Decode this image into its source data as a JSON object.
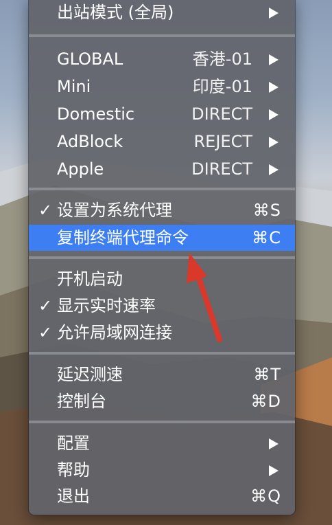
{
  "menu": {
    "top_item": {
      "label": "出站模式 (全局)"
    },
    "proxy_groups": [
      {
        "name": "GLOBAL",
        "value": "香港-01"
      },
      {
        "name": "Mini",
        "value": "印度-01"
      },
      {
        "name": "Domestic",
        "value": "DIRECT"
      },
      {
        "name": "AdBlock",
        "value": "REJECT"
      },
      {
        "name": "Apple",
        "value": "DIRECT"
      }
    ],
    "proxy_section": [
      {
        "label": "设置为系统代理",
        "checked": true,
        "checkmark": "✓",
        "shortcut": "⌘S"
      },
      {
        "label": "复制终端代理命令",
        "checked": false,
        "checkmark": "",
        "shortcut": "⌘C",
        "highlighted": true
      }
    ],
    "startup_section": [
      {
        "label": "开机启动",
        "checked": false,
        "checkmark": ""
      },
      {
        "label": "显示实时速率",
        "checked": true,
        "checkmark": "✓"
      },
      {
        "label": "允许局域网连接",
        "checked": true,
        "checkmark": "✓"
      }
    ],
    "tools_section": [
      {
        "label": "延迟测速",
        "shortcut": "⌘T"
      },
      {
        "label": "控制台",
        "shortcut": "⌘D"
      }
    ],
    "bottom_section": [
      {
        "label": "配置",
        "submenu": true
      },
      {
        "label": "帮助",
        "submenu": true
      },
      {
        "label": "退出",
        "shortcut": "⌘Q"
      }
    ]
  },
  "colors": {
    "menu_bg": "#62646a",
    "highlight": "#3d7ff2",
    "annotation_arrow": "#d9382a",
    "text": "#ffffff"
  },
  "icons": {
    "submenu": "chevron-right-icon",
    "check": "checkmark-icon",
    "annotation": "red-arrow-icon"
  }
}
